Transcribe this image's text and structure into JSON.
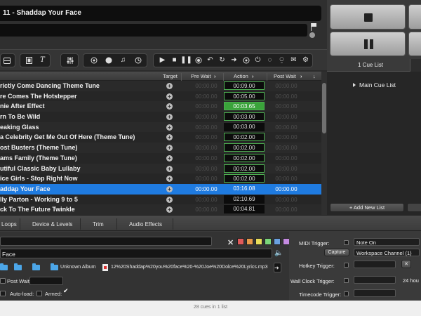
{
  "current_cue": {
    "title": "11 - Shaddap Your Face"
  },
  "toolbar": {
    "groups": [
      {
        "icons": [
          "audio-cue-icon"
        ]
      },
      {
        "icons": [
          "video-cue-icon",
          "text-cue-icon"
        ]
      },
      {
        "icons": [
          "mixer-icon"
        ]
      },
      {
        "icons": [
          "fade-icon",
          "network-icon",
          "music-icon",
          "clock-icon"
        ]
      },
      {
        "icons": [
          "start-icon",
          "stop-icon",
          "pause-icon",
          "record-icon",
          "reset-icon",
          "load-icon",
          "goto-icon",
          "target-icon",
          "arm-icon",
          "disarm-icon",
          "wait-icon",
          "memo-icon",
          "script-icon"
        ]
      }
    ]
  },
  "table": {
    "headers": {
      "target": "Target",
      "pre_wait": "Pre Wait",
      "action": "Action",
      "post_wait": "Post Wait"
    },
    "rows": [
      {
        "name": "rictly Come Dancing Theme Tune",
        "pre_wait": "00:00.00",
        "action": "00:09.00",
        "action_style": "box",
        "post_wait": "00:00.00"
      },
      {
        "name": "re Comes The Hotstepper",
        "pre_wait": "00:00.00",
        "action": "00:05.00",
        "action_style": "box",
        "post_wait": "00:00.00"
      },
      {
        "name": "nie After Effect",
        "pre_wait": "00:00.00",
        "action": "00:03.65",
        "action_style": "green",
        "post_wait": "00:00.00"
      },
      {
        "name": "rn To Be Wild",
        "pre_wait": "00:00.00",
        "action": "00:03.00",
        "action_style": "box",
        "post_wait": "00:00.00"
      },
      {
        "name": "eaking Glass",
        "pre_wait": "00:00.00",
        "action": "00:03.00",
        "action_style": "plain",
        "post_wait": "00:00.00"
      },
      {
        "name": "a Celebrity Get Me Out Of Here (Theme Tune)",
        "pre_wait": "00:00.00",
        "action": "00:02.00",
        "action_style": "box",
        "post_wait": "00:00.00"
      },
      {
        "name": "ost Busters (Theme Tune)",
        "pre_wait": "00:00.00",
        "action": "00:02.00",
        "action_style": "box",
        "post_wait": "00:00.00"
      },
      {
        "name": "ams Family (Theme Tune)",
        "pre_wait": "00:00.00",
        "action": "00:02.00",
        "action_style": "box",
        "post_wait": "00:00.00"
      },
      {
        "name": "utiful Classic Baby Lullaby",
        "pre_wait": "00:00.00",
        "action": "00:02.00",
        "action_style": "box",
        "post_wait": "00:00.00"
      },
      {
        "name": "ice Girls - Stop Right Now",
        "pre_wait": "00:00.00",
        "action": "00:02.00",
        "action_style": "box",
        "post_wait": "00:00.00"
      },
      {
        "name": "addap Your Face",
        "pre_wait": "00:00.00",
        "action": "03:16.08",
        "action_style": "plain",
        "post_wait": "00:00.00",
        "selected": true
      },
      {
        "name": "lly Parton - Working 9 to 5",
        "pre_wait": "00:00.00",
        "action": "02:10.69",
        "action_style": "plain",
        "post_wait": "00:00.00"
      },
      {
        "name": "ck To The Future Twinkle",
        "pre_wait": "00:00.00",
        "action": "00:04.81",
        "action_style": "plain",
        "post_wait": "00:00.00"
      }
    ]
  },
  "cue_lists": {
    "tab_label": "1 Cue List",
    "items": [
      "Main Cue List"
    ],
    "add_button": "+ Add New List"
  },
  "inspector": {
    "tabs": [
      "Loops",
      "Device & Levels",
      "Trim",
      "Audio Effects"
    ],
    "swatch_colors": [
      "#e05a5a",
      "#e89a4a",
      "#e8dd5a",
      "#7ad67a",
      "#6aa0e0",
      "#c48ae0"
    ],
    "cue_name": "Face",
    "path_parts": [
      "Unknown Album"
    ],
    "file_name": "12%20Shaddap%20you%20face%20-%20Joe%20Dolce%20Lyrics.mp3",
    "post_wait_label": "Post Wait:",
    "auto_load_label": "Auto-load:",
    "armed_label": "Armed:",
    "triggers": {
      "midi_label": "MIDI Trigger:",
      "midi_value": "Note On",
      "capture_button": "Capture",
      "midi_channel": "Workspace Channel (1)",
      "hotkey_label": "Hotkey Trigger:",
      "wall_clock_label": "Wall Clock Trigger:",
      "wall_clock_value": "24 hou",
      "timecode_label": "Timecode Trigger:"
    }
  },
  "status_bar": {
    "text": "28 cues in 1 list"
  }
}
